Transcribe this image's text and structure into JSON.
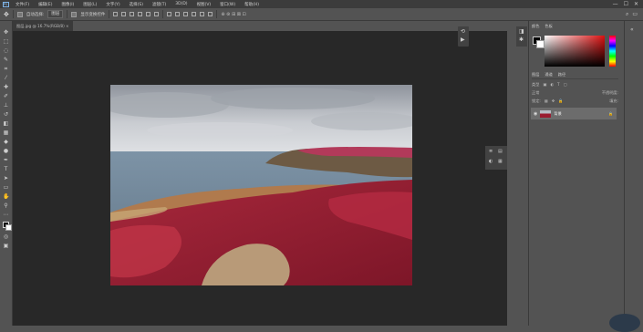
{
  "menu": {
    "logo": "Ps",
    "items": [
      "文件(F)",
      "编辑(E)",
      "图像(I)",
      "图层(L)",
      "文字(Y)",
      "选择(S)",
      "滤镜(T)",
      "3D(D)",
      "视图(V)",
      "窗口(W)",
      "帮助(H)"
    ],
    "window_controls": [
      "—",
      "☐",
      "✕"
    ]
  },
  "options": {
    "auto_select_label": "自动选择:",
    "auto_select_value": "图层",
    "show_transform_label": "显示变换控件"
  },
  "document": {
    "tab_label": "图层.jpg @ 16.7%(RGB/8) ×"
  },
  "panels": {
    "color_tabs": [
      "颜色",
      "色板"
    ],
    "layers_tabs": [
      "图层",
      "通道",
      "路径"
    ],
    "kind_filter": "类型",
    "blend_mode": "正常",
    "opacity_label": "不透明度:",
    "lock_label": "锁定:",
    "fill_label": "填充:",
    "layer_name": "背景"
  },
  "colors": {
    "accent": "#7fb3e6",
    "heather": "#9a1c30"
  }
}
